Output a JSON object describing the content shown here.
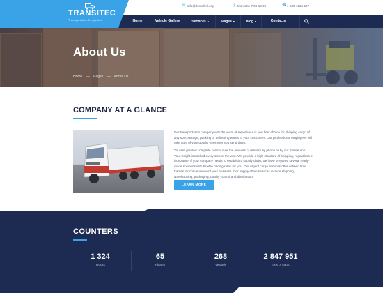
{
  "brand": {
    "name": "TRANSITEC",
    "tagline": "Transportation & Logistics"
  },
  "contacts": {
    "email": "info@demolink.org",
    "hours": "Mon-Sat: 7:00-19:00",
    "phone": "1-800-1234-567"
  },
  "nav": {
    "home": "Home",
    "gallery": "Vehicle Gallery",
    "services": "Services",
    "pages": "Pages",
    "blog": "Blog",
    "contacts": "Contacts"
  },
  "hero": {
    "title": "About Us",
    "breadcrumbs": [
      "Home",
      "—",
      "Pages",
      "—",
      "About Us"
    ]
  },
  "company": {
    "title": "COMPANY AT A GLANCE",
    "paragraph_1": "Our transportation company with 30 years of experience is you best choice for shipping cargo of any size, storage, packing or delivering wares to your customers. Our professional employees will take care of your goods, whenever you send them.",
    "paragraph_2": "You are granted complete control over the process of delivery by phone or by our mobile app. Your freight is tracked every step of the way. We provide a high standard of shipping, regardless of its volume. If your company needs to establish a supply chain, we have prepared several ready-made solutions with flexible pricing rates for you. Our urgent cargo services offer defined time frames for convenience of your business. Our supply chain services include shipping, warehousing, packaging, quality control and distribution.",
    "button": "LEARN MORE"
  },
  "counters": {
    "title": "COUNTERS",
    "items": [
      {
        "value": "1 324",
        "label": "Trucks"
      },
      {
        "value": "65",
        "label": "Planes"
      },
      {
        "value": "268",
        "label": "Vessels"
      },
      {
        "value": "2 847 951",
        "label": "Tons of cargo"
      }
    ]
  },
  "colors": {
    "accent": "#3aa2e6",
    "navy": "#1d2b52",
    "text": "#5a6377"
  },
  "icons": {
    "email": "mail-icon",
    "hours": "clock-icon",
    "phone": "phone-icon",
    "search": "search-icon",
    "logo": "truck-icon"
  }
}
